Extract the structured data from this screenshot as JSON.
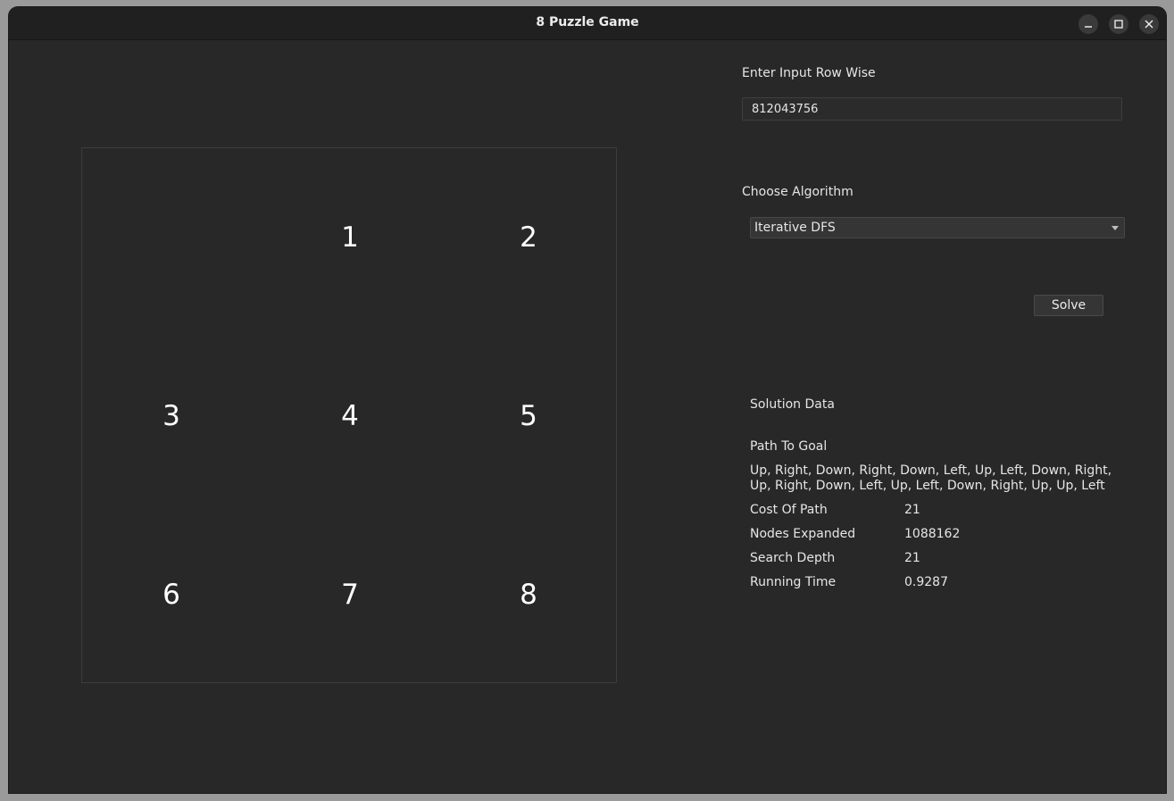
{
  "window": {
    "title": "8 Puzzle Game",
    "minimize_label": "—",
    "maximize_label": "",
    "close_label": ""
  },
  "board": {
    "tiles": [
      "",
      "1",
      "2",
      "3",
      "4",
      "5",
      "6",
      "7",
      "8"
    ]
  },
  "input": {
    "label": "Enter Input Row Wise",
    "value": "812043756"
  },
  "algorithm": {
    "label": "Choose Algorithm",
    "selected": "Iterative DFS"
  },
  "solve_button": "Solve",
  "solution": {
    "heading": "Solution Data",
    "path_label": "Path To Goal",
    "path_value": "Up, Right, Down, Right, Down, Left, Up, Left, Down, Right, Up, Right, Down, Left, Up, Left, Down, Right, Up, Up, Left",
    "cost_label": "Cost Of Path",
    "cost_value": "21",
    "nodes_label": "Nodes Expanded",
    "nodes_value": "1088162",
    "depth_label": "Search Depth",
    "depth_value": "21",
    "time_label": "Running Time",
    "time_value": "0.9287"
  }
}
